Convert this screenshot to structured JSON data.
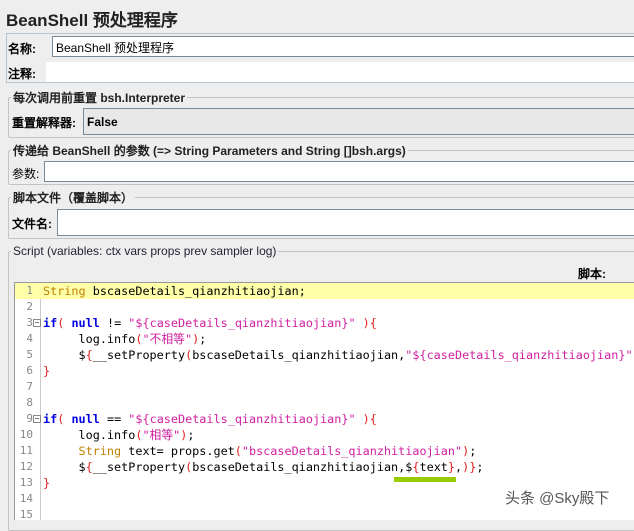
{
  "title": "BeanShell 预处理程序",
  "name_label": "名称:",
  "name_value": "BeanShell 预处理程序",
  "comment_label": "注释:",
  "comment_value": "",
  "reset_group": "每次调用前重置 bsh.Interpreter",
  "reset_label": "重置解释器:",
  "reset_value": "False",
  "params_group": "传递给 BeanShell 的参数 (=> String Parameters and String []bsh.args)",
  "params_label": "参数:",
  "params_value": "",
  "file_group": "脚本文件（覆盖脚本）",
  "file_label": "文件名:",
  "file_value": "",
  "script_group": "Script (variables: ctx vars props prev sampler log)",
  "script_label": "脚本:",
  "highlight_color": "#99cc00",
  "watermark": "头条 @Sky殿下",
  "code_lines": [
    [
      [
        "type",
        "String"
      ],
      [
        "pl",
        " bscaseDetails_qianzhitiaojian;"
      ]
    ],
    [],
    [
      [
        "kw",
        "if"
      ],
      [
        "br",
        "("
      ],
      [
        "pl",
        " "
      ],
      [
        "kw",
        "null"
      ],
      [
        "pl",
        " != "
      ],
      [
        "str",
        "\"${caseDetails_qianzhitiaojian}\""
      ],
      [
        "pl",
        " "
      ],
      [
        "br",
        ")"
      ],
      [
        "br",
        "{"
      ]
    ],
    [
      [
        "pl",
        "     log.info"
      ],
      [
        "br",
        "("
      ],
      [
        "str",
        "\"不相等\""
      ],
      [
        "br",
        ")"
      ],
      [
        "pl",
        ";"
      ]
    ],
    [
      [
        "pl",
        "     $"
      ],
      [
        "br",
        "{"
      ],
      [
        "pl",
        "__setProperty"
      ],
      [
        "br",
        "("
      ],
      [
        "pl",
        "bscaseDetails_qianzhitiaojian,"
      ],
      [
        "str",
        "\"${caseDetails_qianzhitiaojian}\""
      ],
      [
        "pl",
        ","
      ],
      [
        "br",
        ")"
      ]
    ],
    [
      [
        "br",
        "}"
      ]
    ],
    [],
    [],
    [
      [
        "kw",
        "if"
      ],
      [
        "br",
        "("
      ],
      [
        "pl",
        " "
      ],
      [
        "kw",
        "null"
      ],
      [
        "pl",
        " == "
      ],
      [
        "str",
        "\"${caseDetails_qianzhitiaojian}\""
      ],
      [
        "pl",
        " "
      ],
      [
        "br",
        ")"
      ],
      [
        "br",
        "{"
      ]
    ],
    [
      [
        "pl",
        "     log.info"
      ],
      [
        "br",
        "("
      ],
      [
        "str",
        "\"相等\""
      ],
      [
        "br",
        ")"
      ],
      [
        "pl",
        ";"
      ]
    ],
    [
      [
        "type",
        "     String"
      ],
      [
        "pl",
        " text= props.get"
      ],
      [
        "br",
        "("
      ],
      [
        "str",
        "\"bscaseDetails_qianzhitiaojian\""
      ],
      [
        "br",
        ")"
      ],
      [
        "pl",
        ";"
      ]
    ],
    [
      [
        "pl",
        "     $"
      ],
      [
        "br",
        "{"
      ],
      [
        "pl",
        "__setProperty"
      ],
      [
        "br",
        "("
      ],
      [
        "pl",
        "bscaseDetails_qianzhitiaojian,$"
      ],
      [
        "br",
        "{"
      ],
      [
        "pl",
        "text"
      ],
      [
        "br",
        "}"
      ],
      [
        "pl",
        ","
      ],
      [
        "br",
        ")"
      ],
      [
        "br",
        "}"
      ],
      [
        "pl",
        ";"
      ]
    ],
    [
      [
        "br",
        "}"
      ]
    ],
    [],
    []
  ],
  "fold_lines": [
    3,
    9
  ]
}
